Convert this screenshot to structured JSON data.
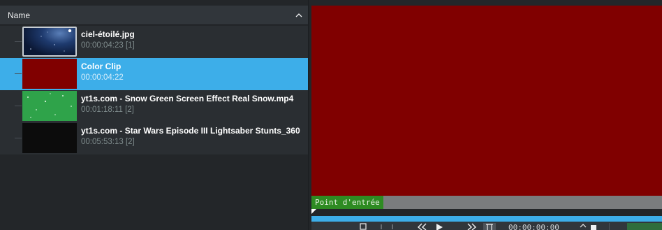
{
  "bin": {
    "column_header": "Name",
    "sort_icon": "chevron-up-icon",
    "clips": [
      {
        "name": "ciel-étoilé.jpg",
        "meta": "00:00:04:23 [1]",
        "thumb": "starry-sky",
        "selected": false
      },
      {
        "name": "Color Clip",
        "meta": "00:00:04:22",
        "thumb": "red",
        "selected": true
      },
      {
        "name": "yt1s.com - Snow Green Screen Effect Real Snow.mp4",
        "meta": "00:01:18:11 [2]",
        "thumb": "green",
        "selected": false
      },
      {
        "name": "yt1s.com - Star Wars Episode III Lightsaber Stunts_360",
        "meta": "00:05:53:13 [2]",
        "thumb": "black",
        "selected": false
      }
    ]
  },
  "monitor": {
    "inpoint_label": "Point d'entrée",
    "timecode_partial": "00:00:00:00",
    "colors": {
      "video_bg": "#800000",
      "inpoint_bg": "#2e8b22",
      "progress": "#3daee9",
      "selection": "#3daee9"
    }
  }
}
